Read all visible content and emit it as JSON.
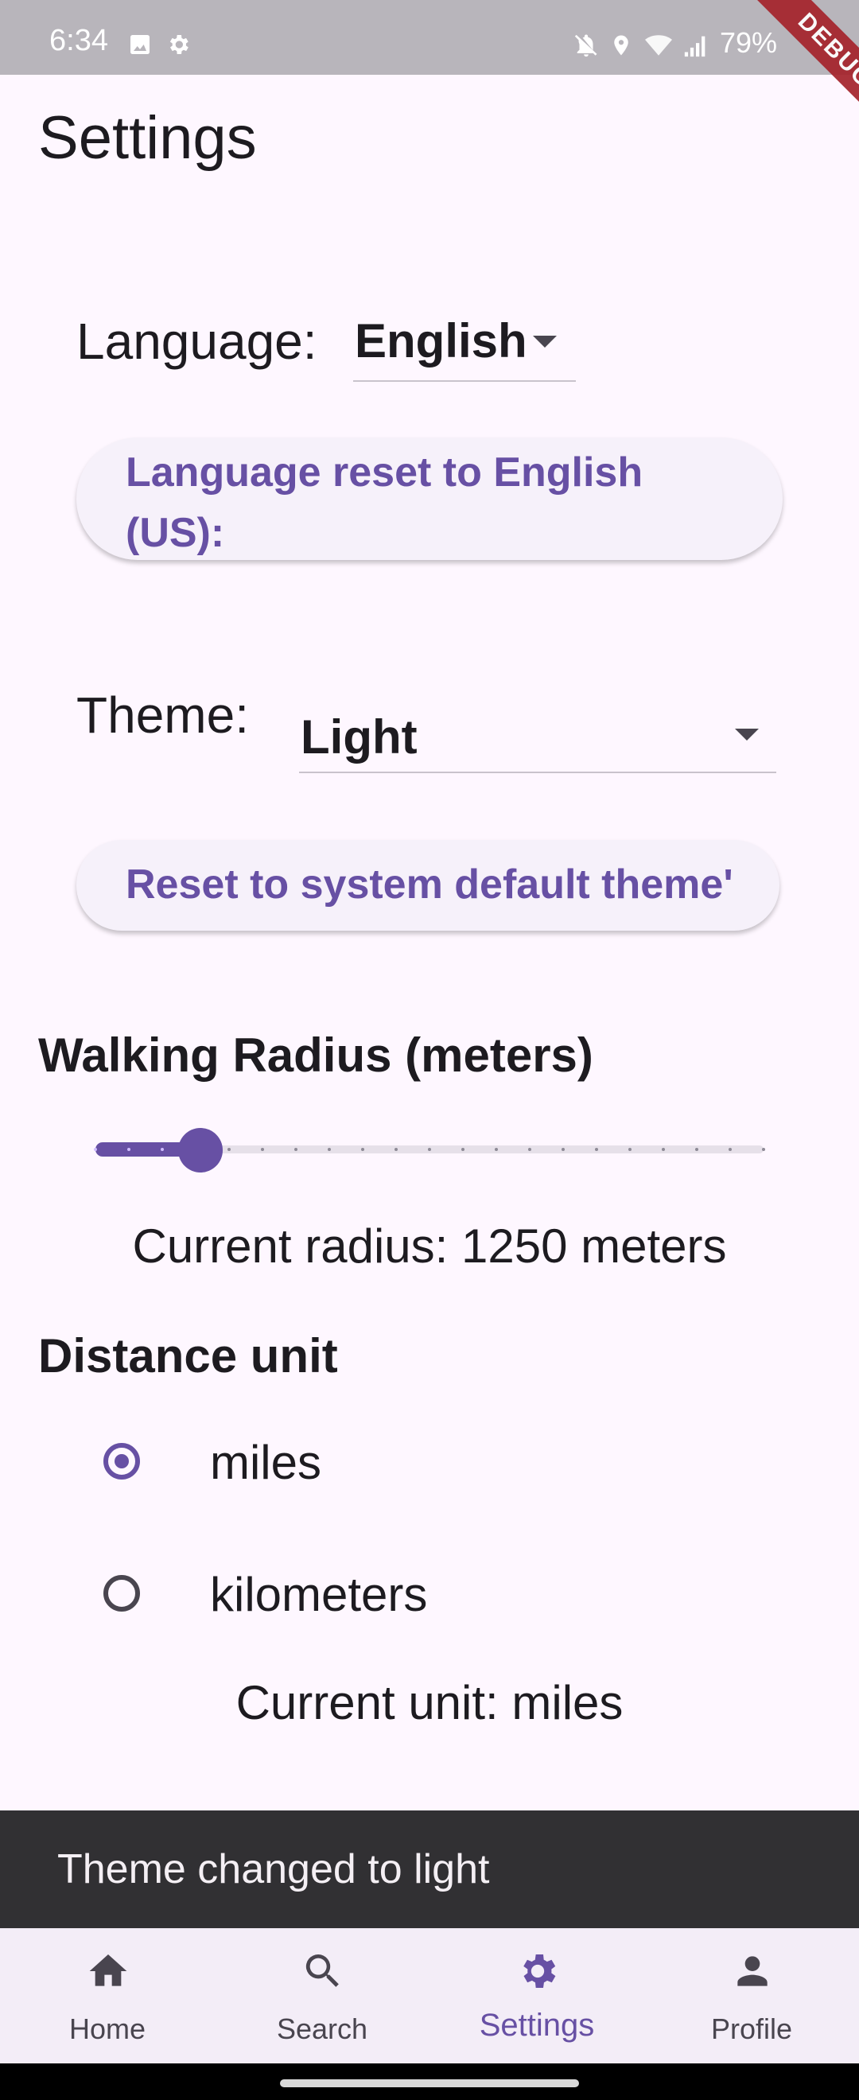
{
  "status_bar": {
    "time": "6:34",
    "battery": "79%"
  },
  "debug_banner": "DEBUG",
  "page_title": "Settings",
  "language": {
    "label": "Language:",
    "value": "English",
    "reset_button": "Language reset to English (US):"
  },
  "theme": {
    "label": "Theme:",
    "value": "Light",
    "reset_button": "Reset to system default theme'"
  },
  "walking_radius": {
    "title": "Walking Radius (meters)",
    "slider_value_fraction": 0.15,
    "current_text": "Current radius: 1250 meters"
  },
  "distance_unit": {
    "title": "Distance unit",
    "options": [
      {
        "label": "miles",
        "selected": true
      },
      {
        "label": "kilometers",
        "selected": false
      }
    ],
    "current_text": "Current unit: miles"
  },
  "snackbar": "Theme changed to light",
  "bottom_nav": [
    {
      "label": "Home",
      "icon": "home-icon",
      "active": false
    },
    {
      "label": "Search",
      "icon": "search-icon",
      "active": false
    },
    {
      "label": "Settings",
      "icon": "gear-icon",
      "active": true
    },
    {
      "label": "Profile",
      "icon": "person-icon",
      "active": false
    }
  ],
  "colors": {
    "accent": "#6750A4",
    "background": "#FEF7FF",
    "snackbar": "#313033",
    "nav_background": "#F3EDF7"
  }
}
